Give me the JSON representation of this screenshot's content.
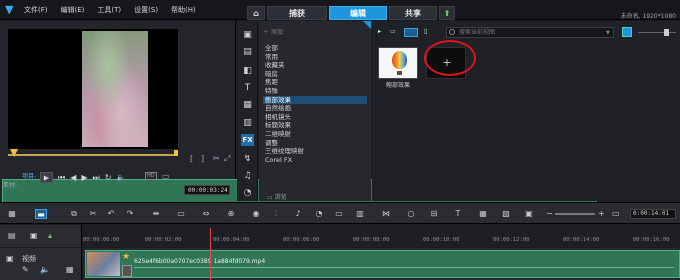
{
  "titlebar": {
    "logo_icon": "corel-logo-icon",
    "menu": [
      "文件(F)",
      "编辑(E)",
      "工具(T)",
      "设置(S)",
      "帮助(H)"
    ],
    "tabs": {
      "capture": "捕获",
      "edit": "编辑",
      "share": "共享"
    },
    "project_info": "未命名, 1920*1080"
  },
  "player": {
    "mode_project": "项目-",
    "mode_clip": "素材-",
    "timecode": "00:00:03:24",
    "hd_badge": "HD"
  },
  "library": {
    "add_label": "添加",
    "browse_label": "浏览",
    "categories": [
      "全部",
      "常用",
      "收藏夹",
      "暗房",
      "焦距",
      "特殊",
      "鲍部效果",
      "自然绘画",
      "相机镜头",
      "标题效果",
      "二维映射",
      "调整",
      "三维纹理映射",
      "Corel FX"
    ],
    "selected_category": "鲍部效果",
    "search_placeholder": "搜索当前视图",
    "items": [
      {
        "label": "鲍部效果"
      }
    ]
  },
  "timeline": {
    "timecode": "0:00:14:01",
    "ruler_ticks": [
      "00:00:00:00",
      "00:00:02:00",
      "00:00:04:00",
      "00:00:06:00",
      "00:00:08:00",
      "00:00:10:00",
      "00:00:12:00",
      "00:00:14:00",
      "00:00:16:00"
    ],
    "track_label": "视频",
    "clip_name": "625e4f6b00a0707ec0389 1a884fd079.mp4"
  },
  "colors": {
    "accent": "#1d96dd",
    "highlight_circle": "#e0141a",
    "clip_green": "#2f7556"
  }
}
